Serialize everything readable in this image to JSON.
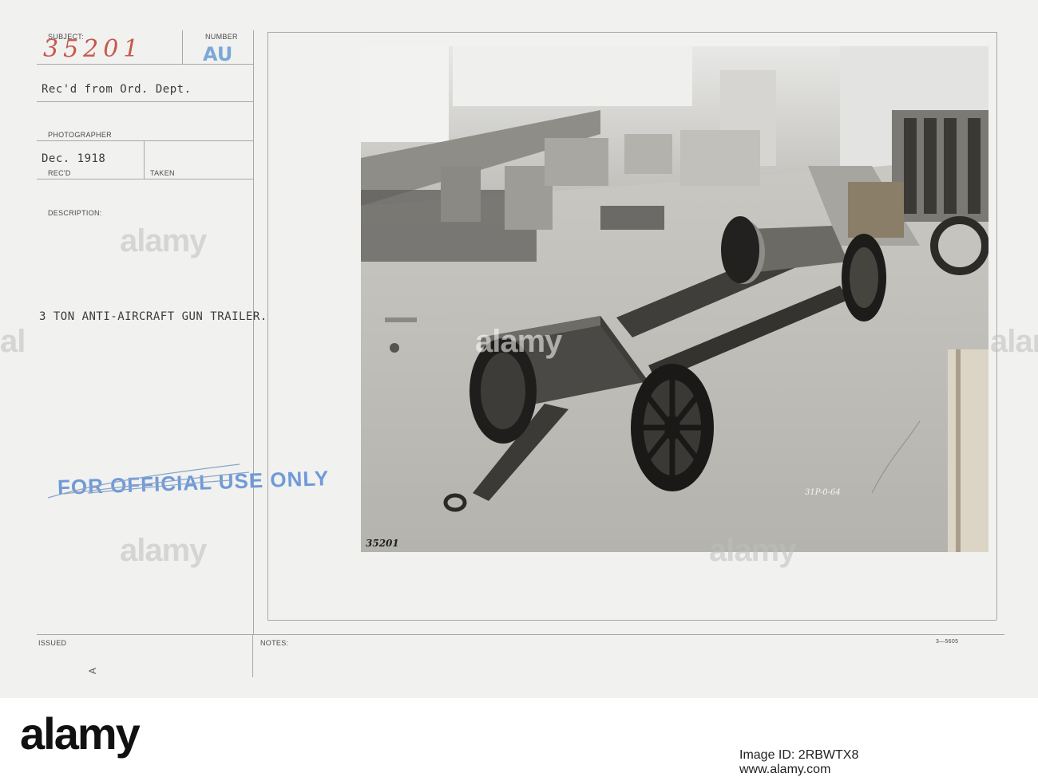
{
  "card": {
    "subject_label": "SUBJECT:",
    "subject_number": "35201",
    "number_label": "NUMBER",
    "number_value": "AU",
    "received_from": "Rec'd from Ord. Dept.",
    "photographer_label": "PHOTOGRAPHER",
    "date": "Dec. 1918",
    "recd_label": "REC'D",
    "taken_label": "TAKEN",
    "description_label": "DESCRIPTION:",
    "description": "3 TON ANTI-AIRCRAFT GUN TRAILER.",
    "stamp": "FOR OFFICIAL USE ONLY",
    "issued_label": "ISSUED",
    "notes_label": "NOTES:",
    "form_code": "3—5605",
    "margin_mark": "A"
  },
  "photo": {
    "negative_number": "35201",
    "plate_code": "31P-0-64"
  },
  "watermark": {
    "text": "alamy"
  },
  "footer": {
    "brand": "alamy",
    "image_id_text": "Image ID: 2RBWTX8",
    "url": "www.alamy.com"
  },
  "colors": {
    "card": "#f1f1ef",
    "stamp_blue": "#6f9ad8",
    "handwriting_red": "#c6584f"
  }
}
